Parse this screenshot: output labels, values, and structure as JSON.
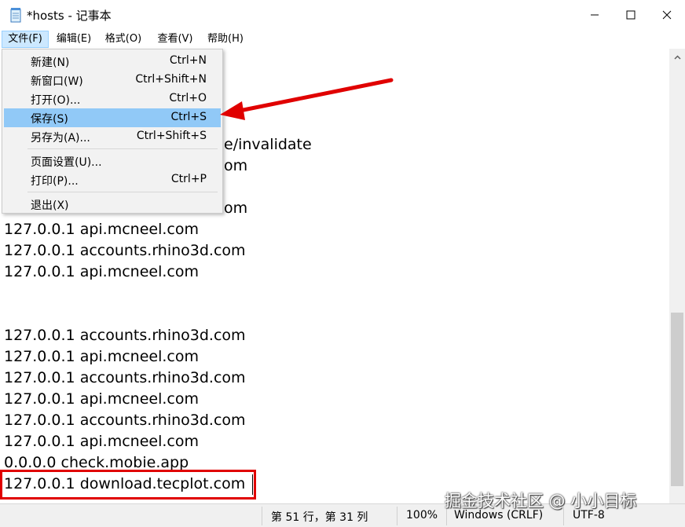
{
  "window": {
    "title": "*hosts - 记事本"
  },
  "menu": {
    "items": [
      "文件(F)",
      "编辑(E)",
      "格式(O)",
      "查看(V)",
      "帮助(H)"
    ]
  },
  "file_menu": {
    "items": [
      {
        "label": "新建(N)",
        "shortcut": "Ctrl+N"
      },
      {
        "label": "新窗口(W)",
        "shortcut": "Ctrl+Shift+N"
      },
      {
        "label": "打开(O)...",
        "shortcut": "Ctrl+O"
      },
      {
        "label": "保存(S)",
        "shortcut": "Ctrl+S"
      },
      {
        "label": "另存为(A)...",
        "shortcut": "Ctrl+Shift+S"
      },
      {
        "label": "页面设置(U)...",
        "shortcut": ""
      },
      {
        "label": "打印(P)...",
        "shortcut": "Ctrl+P"
      },
      {
        "label": "退出(X)",
        "shortcut": ""
      }
    ],
    "highlighted_index": 3
  },
  "editor": {
    "partial_lines": [
      "e/invalidate",
      "om",
      "om"
    ],
    "lines": [
      "127.0.0.1 api.mcneel.com",
      "127.0.0.1 accounts.rhino3d.com",
      "127.0.0.1 api.mcneel.com",
      "",
      "",
      "127.0.0.1 accounts.rhino3d.com",
      "127.0.0.1 api.mcneel.com",
      "127.0.0.1 accounts.rhino3d.com",
      "127.0.0.1 api.mcneel.com",
      "127.0.0.1 accounts.rhino3d.com",
      "127.0.0.1 api.mcneel.com",
      "0.0.0.0 check.mobie.app",
      "127.0.0.1 download.tecplot.com"
    ]
  },
  "status": {
    "position": "第 51 行，第 31 列",
    "zoom": "100%",
    "line_ending": "Windows (CRLF)",
    "encoding": "UTF-8"
  },
  "watermark": "掘金技术社区 @ 小小目标",
  "colors": {
    "highlight": "#91c9f7",
    "annotation": "#e00000",
    "menu_active": "#cce8ff"
  }
}
